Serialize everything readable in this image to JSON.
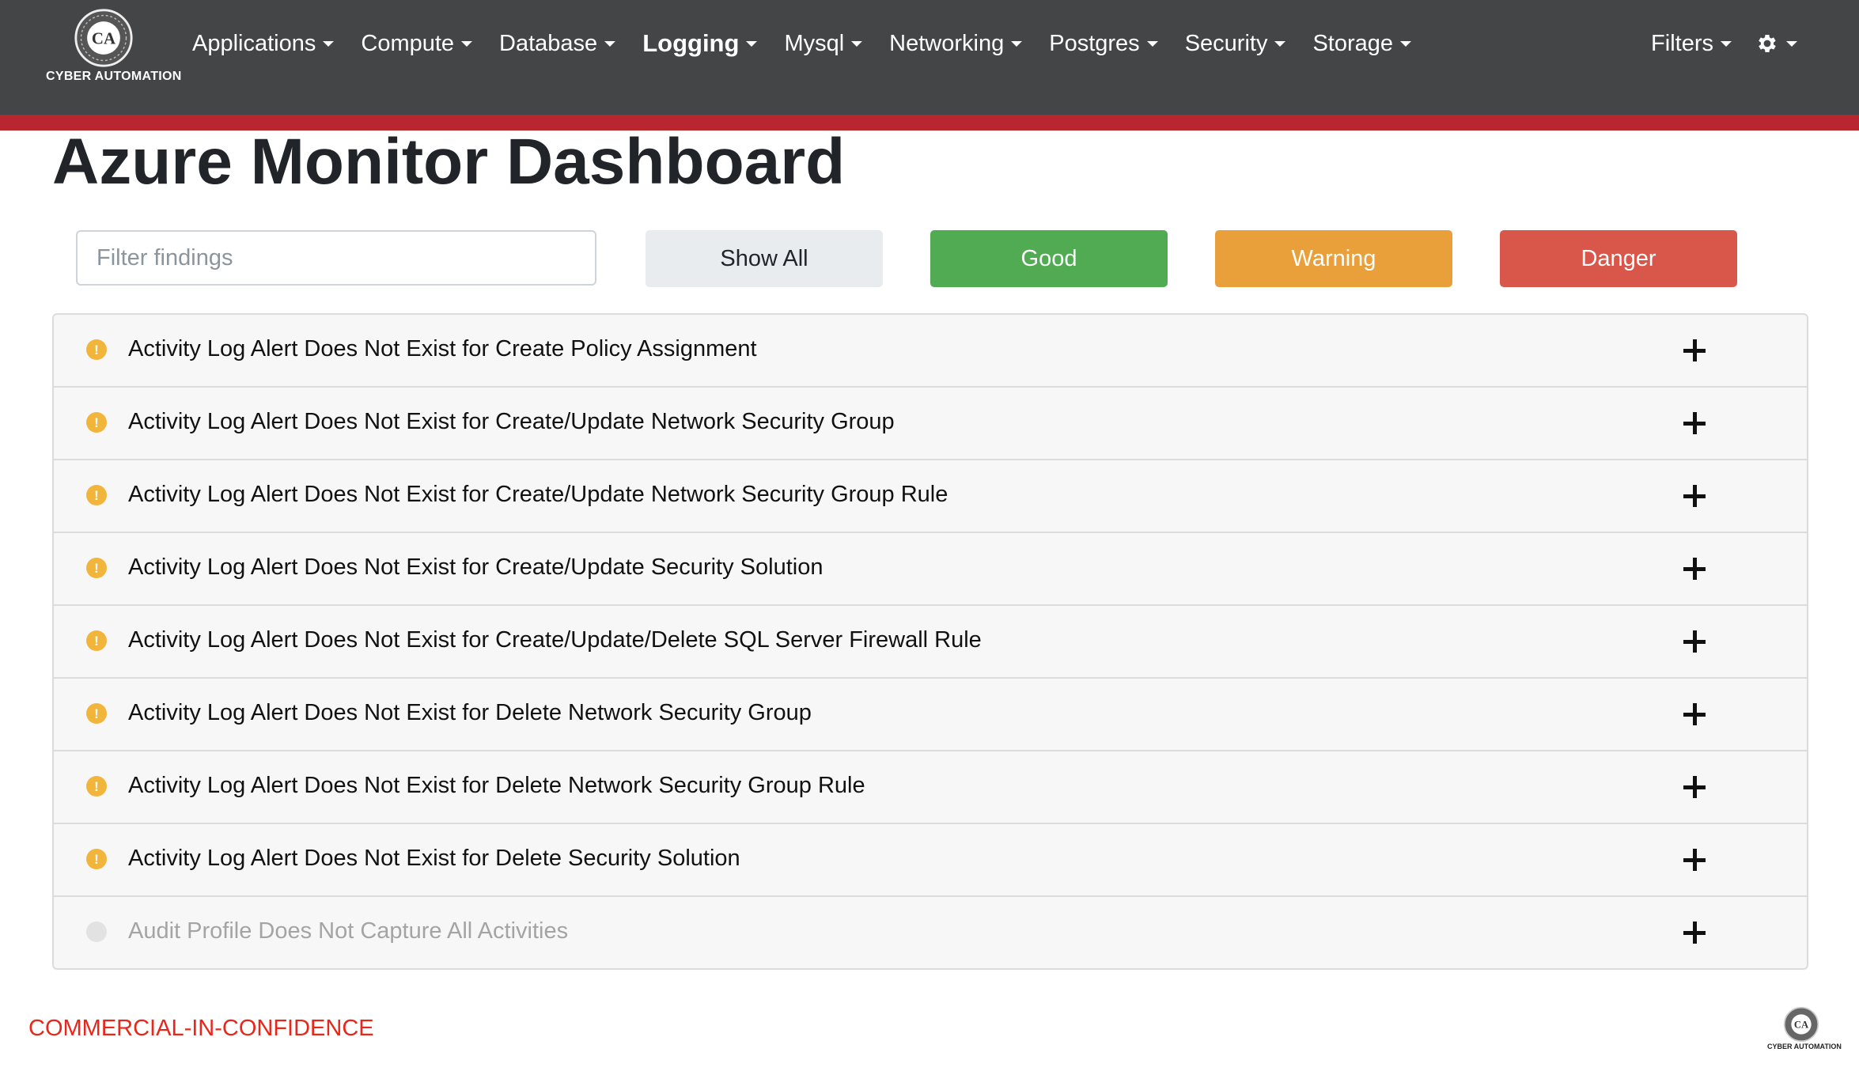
{
  "brand": {
    "name": "CYBER AUTOMATION",
    "logo_icon": "cyber-automation-logo-icon"
  },
  "nav": {
    "items": [
      {
        "label": "Applications",
        "active": false
      },
      {
        "label": "Compute",
        "active": false
      },
      {
        "label": "Database",
        "active": false
      },
      {
        "label": "Logging",
        "active": true
      },
      {
        "label": "Mysql",
        "active": false
      },
      {
        "label": "Networking",
        "active": false
      },
      {
        "label": "Postgres",
        "active": false
      },
      {
        "label": "Security",
        "active": false
      },
      {
        "label": "Storage",
        "active": false
      }
    ],
    "filters_label": "Filters",
    "settings_icon": "gear-icon"
  },
  "page": {
    "title": "Azure Monitor Dashboard"
  },
  "controls": {
    "filter_placeholder": "Filter findings",
    "filter_value": "",
    "show_all": "Show All",
    "good": "Good",
    "warning": "Warning",
    "danger": "Danger"
  },
  "findings": [
    {
      "title": "Activity Log Alert Does Not Exist for Create Policy Assignment",
      "status": "warning",
      "status_icon": "exclamation-circle-icon"
    },
    {
      "title": "Activity Log Alert Does Not Exist for Create/Update Network Security Group",
      "status": "warning",
      "status_icon": "exclamation-circle-icon"
    },
    {
      "title": "Activity Log Alert Does Not Exist for Create/Update Network Security Group Rule",
      "status": "warning",
      "status_icon": "exclamation-circle-icon"
    },
    {
      "title": "Activity Log Alert Does Not Exist for Create/Update Security Solution",
      "status": "warning",
      "status_icon": "exclamation-circle-icon"
    },
    {
      "title": "Activity Log Alert Does Not Exist for Create/Update/Delete SQL Server Firewall Rule",
      "status": "warning",
      "status_icon": "exclamation-circle-icon"
    },
    {
      "title": "Activity Log Alert Does Not Exist for Delete Network Security Group",
      "status": "warning",
      "status_icon": "exclamation-circle-icon"
    },
    {
      "title": "Activity Log Alert Does Not Exist for Delete Network Security Group Rule",
      "status": "warning",
      "status_icon": "exclamation-circle-icon"
    },
    {
      "title": "Activity Log Alert Does Not Exist for Delete Security Solution",
      "status": "warning",
      "status_icon": "exclamation-circle-icon"
    },
    {
      "title": "Audit Profile Does Not Capture All Activities",
      "status": "not-applicable",
      "status_icon": "grey-circle-icon"
    }
  ],
  "footer": {
    "classification": "COMMERCIAL-IN-CONFIDENCE",
    "logo_text": "CYBER AUTOMATION"
  },
  "colors": {
    "navbar": "#444547",
    "accent_stripe": "#b8262f",
    "good": "#51ab53",
    "warning": "#eaa03a",
    "danger": "#d8574a",
    "warning_dot": "#f2b53b",
    "classification_text": "#e8271a"
  }
}
